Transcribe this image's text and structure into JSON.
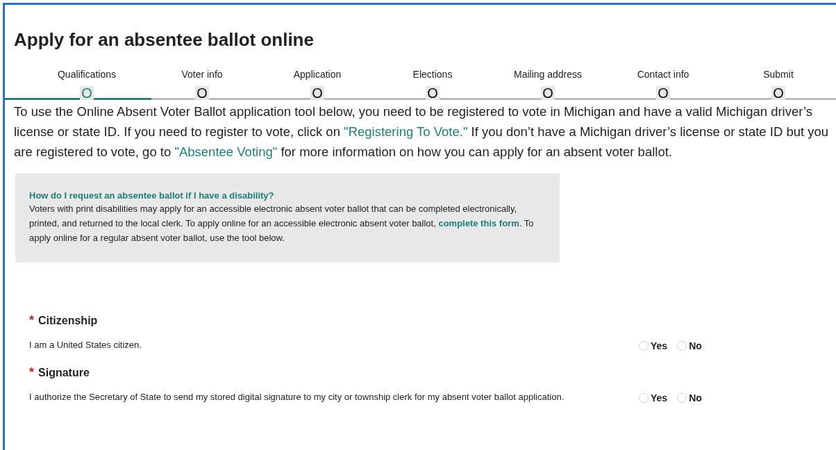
{
  "title": "Apply for an absentee ballot online",
  "steps": [
    {
      "label": "Qualifications",
      "marker": "O",
      "selected": true
    },
    {
      "label": "Voter info",
      "marker": "O",
      "selected": false
    },
    {
      "label": "Application",
      "marker": "O",
      "selected": false
    },
    {
      "label": "Elections",
      "marker": "O",
      "selected": false
    },
    {
      "label": "Mailing address",
      "marker": "O",
      "selected": false
    },
    {
      "label": "Contact info",
      "marker": "O",
      "selected": false
    },
    {
      "label": "Submit",
      "marker": "O",
      "selected": false
    }
  ],
  "intro": [
    {
      "kind": "text",
      "text": "To use the Online Absent Voter Ballot application tool below, you need to be registered to vote in Michigan and have a valid Michigan driver’s license or state ID. If you need to register to vote, click on "
    },
    {
      "kind": "link",
      "text": "\"Registering To Vote.\""
    },
    {
      "kind": "text",
      "text": " If you don’t have a Michigan driver’s license or state ID but you are registered to vote, go to "
    },
    {
      "kind": "link",
      "text": "\"Absentee Voting\""
    },
    {
      "kind": "text",
      "text": " for more information on how you can apply for an absent voter ballot."
    }
  ],
  "callout": {
    "heading": "How do I request an absentee ballot if I have a disability?",
    "body": [
      {
        "kind": "text",
        "text": "Voters with print disabilities may apply for an accessible electronic absent voter ballot that can be completed electronically, printed, and returned to the local clerk. To apply online for an accessible electronic absent voter ballot, "
      },
      {
        "kind": "link",
        "text": "complete this form"
      },
      {
        "kind": "text",
        "text": ". To apply online for a regular absent voter ballot, use the tool below."
      }
    ]
  },
  "questions": [
    {
      "required_mark": "*",
      "label": "Citizenship",
      "description": "I am a United States citizen.",
      "options": [
        {
          "label": "Yes",
          "selected": false
        },
        {
          "label": "No",
          "selected": false
        }
      ]
    },
    {
      "required_mark": "*",
      "label": "Signature",
      "description": "I authorize the Secretary of State to send my stored digital signature to my city or township clerk for my absent voter ballot application.",
      "options": [
        {
          "label": "Yes",
          "selected": false
        },
        {
          "label": "No",
          "selected": false
        }
      ]
    }
  ]
}
